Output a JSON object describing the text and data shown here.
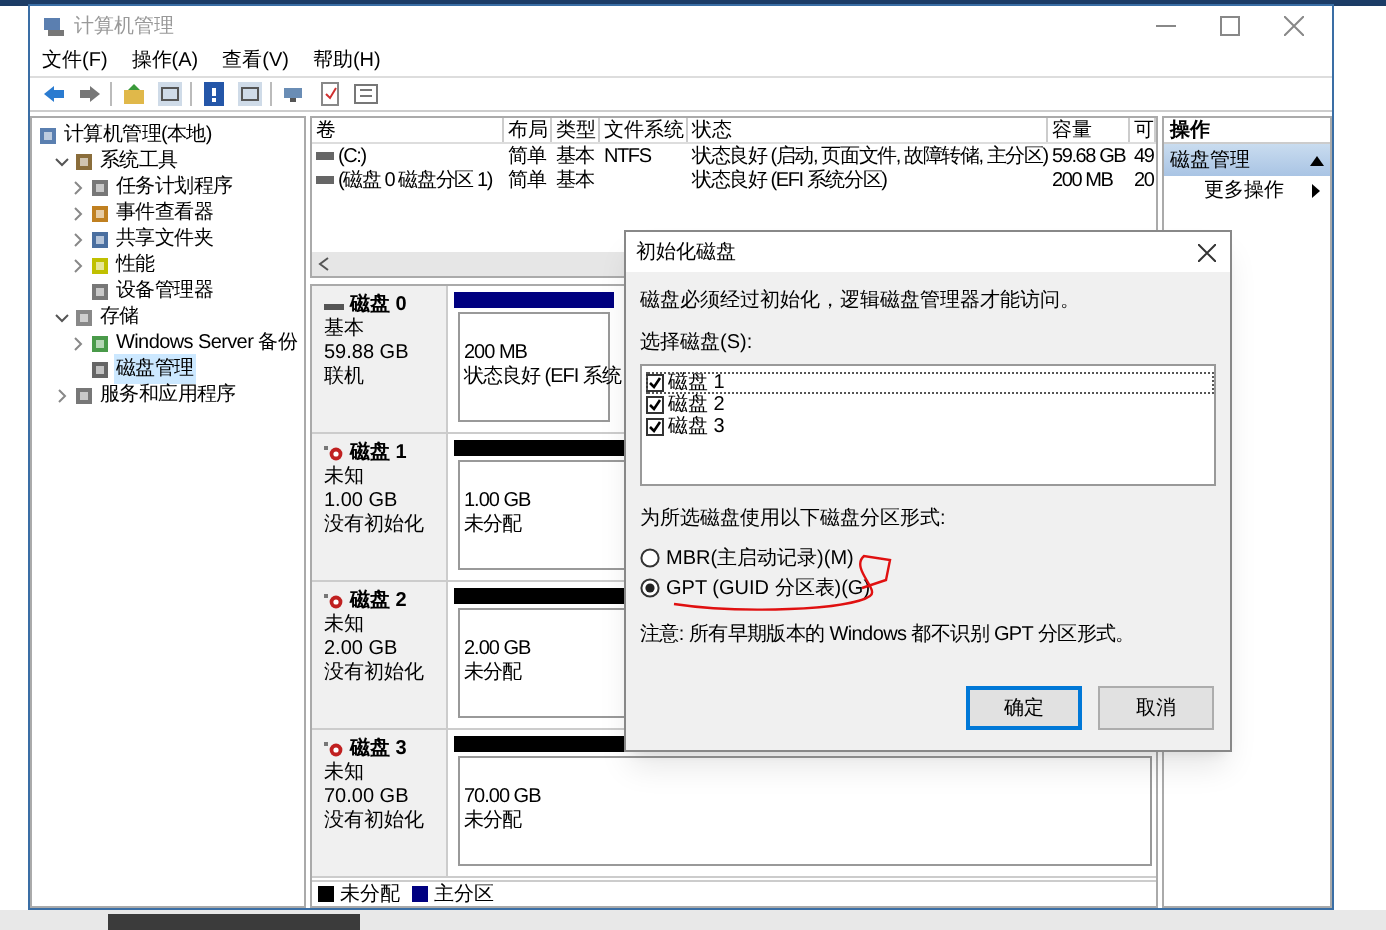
{
  "window": {
    "title": "计算机管理"
  },
  "menu": [
    "文件(F)",
    "操作(A)",
    "查看(V)",
    "帮助(H)"
  ],
  "tree": [
    {
      "label": "计算机管理(本地)",
      "selected": false,
      "children": [
        {
          "label": "系统工具",
          "expanded": true,
          "selected": false,
          "children": [
            {
              "label": "任务计划程序",
              "expanded": false,
              "selected": false
            },
            {
              "label": "事件查看器",
              "expanded": false,
              "selected": false
            },
            {
              "label": "共享文件夹",
              "expanded": false,
              "selected": false
            },
            {
              "label": "性能",
              "expanded": false,
              "selected": false
            },
            {
              "label": "设备管理器",
              "selected": false
            }
          ]
        },
        {
          "label": "存储",
          "expanded": true,
          "selected": false,
          "children": [
            {
              "label": "Windows Server 备份",
              "expanded": false,
              "selected": false
            },
            {
              "label": "磁盘管理",
              "selected": true
            }
          ]
        },
        {
          "label": "服务和应用程序",
          "expanded": false,
          "selected": false
        }
      ]
    }
  ],
  "volumes": {
    "columns": [
      "卷",
      "布局",
      "类型",
      "文件系统",
      "状态",
      "容量",
      "可"
    ],
    "rows": [
      [
        "(C:)",
        "简单",
        "基本",
        "NTFS",
        "状态良好 (启动, 页面文件, 故障转储, 主分区)",
        "59.68 GB",
        "49"
      ],
      [
        "(磁盘 0 磁盘分区 1)",
        "简单",
        "基本",
        "",
        "状态良好 (EFI 系统分区)",
        "200 MB",
        "20"
      ]
    ]
  },
  "disks": [
    {
      "name": "磁盘 0",
      "type": "基本",
      "size": "59.88 GB",
      "status": "联机",
      "initialized": true,
      "partitions": [
        {
          "kind": "primary",
          "size": "200 MB",
          "status": "状态良好 (EFI 系统"
        }
      ]
    },
    {
      "name": "磁盘 1",
      "type": "未知",
      "size": "1.00 GB",
      "status": "没有初始化",
      "initialized": false,
      "partitions": [
        {
          "kind": "unallocated",
          "size": "1.00 GB",
          "status": "未分配"
        }
      ]
    },
    {
      "name": "磁盘 2",
      "type": "未知",
      "size": "2.00 GB",
      "status": "没有初始化",
      "initialized": false,
      "partitions": [
        {
          "kind": "unallocated",
          "size": "2.00 GB",
          "status": "未分配"
        }
      ]
    },
    {
      "name": "磁盘 3",
      "type": "未知",
      "size": "70.00 GB",
      "status": "没有初始化",
      "initialized": false,
      "partitions": [
        {
          "kind": "unallocated",
          "size": "70.00 GB",
          "status": "未分配"
        }
      ]
    }
  ],
  "legend": [
    {
      "label": "未分配",
      "color": "#000000"
    },
    {
      "label": "主分区",
      "color": "#000080"
    }
  ],
  "actions": {
    "title": "操作",
    "section": "磁盘管理",
    "items": [
      "更多操作"
    ]
  },
  "dialog": {
    "title": "初始化磁盘",
    "message": "磁盘必须经过初始化，逻辑磁盘管理器才能访问。",
    "list_label": "选择磁盘(S):",
    "disks": [
      {
        "label": "磁盘 1",
        "checked": true,
        "selected": true
      },
      {
        "label": "磁盘 2",
        "checked": true,
        "selected": false
      },
      {
        "label": "磁盘 3",
        "checked": true,
        "selected": false
      }
    ],
    "style_label": "为所选磁盘使用以下磁盘分区形式:",
    "options": [
      {
        "label": "MBR(主启动记录)(M)",
        "selected": false
      },
      {
        "label": "GPT (GUID 分区表)(G)",
        "selected": true
      }
    ],
    "note": "注意: 所有早期版本的 Windows 都不识别 GPT 分区形式。",
    "buttons": [
      {
        "label": "确定",
        "default": true
      },
      {
        "label": "取消",
        "default": false
      }
    ]
  }
}
